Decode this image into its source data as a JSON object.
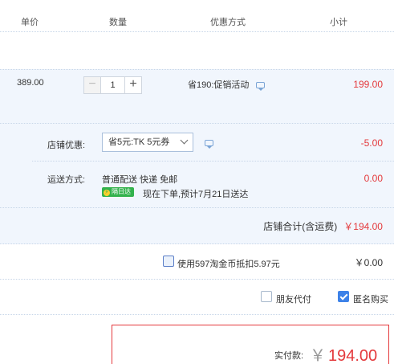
{
  "header": {
    "unit_price": "单价",
    "quantity": "数量",
    "promotion": "优惠方式",
    "subtotal": "小计"
  },
  "item": {
    "price": "389.00",
    "quantity": "1",
    "minus": "−",
    "plus": "+",
    "promotion": "省190:促销活动",
    "subtotal": "199.00"
  },
  "shop": {
    "coupon_label": "店铺优惠:",
    "coupon_selected": "省5元:TK 5元券",
    "coupon_discount": "-5.00",
    "shipping_label": "运送方式:",
    "shipping_method": "普通配送 快递 免邮",
    "tomorrow_badge": "隔日达",
    "delivery_note": "现在下单,预计7月21日送达",
    "shipping_fee": "0.00",
    "total_label": "店铺合计(含运费)",
    "total_amount": "￥194.00"
  },
  "coins": {
    "label": "使用597淘金币抵扣5.97元",
    "amount": "￥0.00",
    "checked": false
  },
  "options": {
    "friend_pay": "朋友代付",
    "friend_pay_checked": false,
    "anonymous": "匿名购买",
    "anonymous_checked": true
  },
  "payment": {
    "label": "实付款:",
    "currency": "￥",
    "amount": "194.00"
  },
  "colors": {
    "accent_red": "#e4393c",
    "row_bg": "#f1f6fd",
    "check_blue": "#3d82e8"
  }
}
